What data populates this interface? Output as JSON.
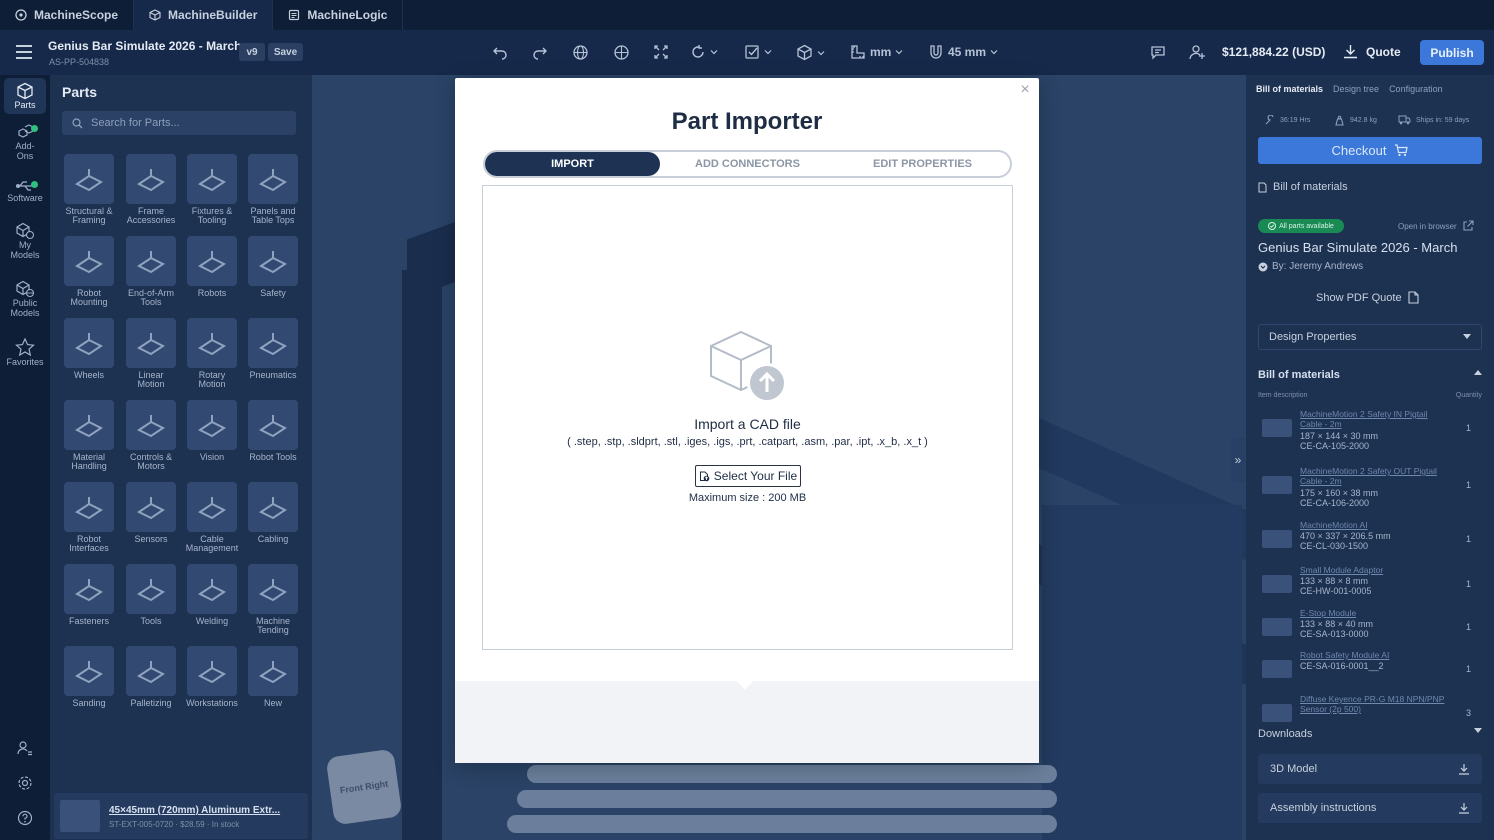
{
  "app_tabs": [
    {
      "label": "MachineScope",
      "icon": "scope-icon"
    },
    {
      "label": "MachineBuilder",
      "icon": "cube-icon"
    },
    {
      "label": "MachineLogic",
      "icon": "logic-icon"
    }
  ],
  "toolbar": {
    "design_title": "Genius Bar Simulate 2026 - March",
    "design_number": "AS-PP-504838",
    "version": "v9",
    "save_label": "Save",
    "units": "mm",
    "snap": "45 mm",
    "price": "$121,884.22 (USD)",
    "quote_label": "Quote",
    "publish_label": "Publish"
  },
  "rail": [
    {
      "label": "Parts",
      "icon": "parts-icon",
      "active": true
    },
    {
      "label": "Add-\nOns",
      "icon": "addons-icon",
      "dot": true
    },
    {
      "label": "Software",
      "icon": "software-icon",
      "dot": true
    },
    {
      "label": "My\nModels",
      "icon": "my-models-icon"
    },
    {
      "label": "Public\nModels",
      "icon": "public-models-icon"
    },
    {
      "label": "Favorites",
      "icon": "star-icon"
    }
  ],
  "parts_panel": {
    "title": "Parts",
    "search_placeholder": "Search for Parts...",
    "categories": [
      "Structural &\nFraming",
      "Frame\nAccessories",
      "Fixtures &\nTooling",
      "Panels and\nTable Tops",
      "Robot\nMounting",
      "End-of-Arm\nTools",
      "Robots",
      "Safety",
      "Wheels",
      "Linear\nMotion",
      "Rotary\nMotion",
      "Pneumatics",
      "Material\nHandling",
      "Controls &\nMotors",
      "Vision",
      "Robot Tools",
      "Robot\nInterfaces",
      "Sensors",
      "Cable\nManagement",
      "Cabling",
      "Fasteners",
      "Tools",
      "Welding",
      "Machine\nTending",
      "Sanding",
      "Palletizing",
      "Workstations",
      "New"
    ],
    "recent_part": {
      "name": "45×45mm (720mm) Aluminum Extr...",
      "sub": "ST-EXT-005-0720 · $28.59 · In stock"
    }
  },
  "view_cube": {
    "face1": "Front",
    "face2": "Right"
  },
  "right_panel": {
    "tabs": [
      "Bill of materials",
      "Design tree",
      "Configuration"
    ],
    "stats": {
      "hours": "36:19 Hrs",
      "weight": "942.8 kg",
      "ships": "Ships in: 59 days"
    },
    "checkout_label": "Checkout",
    "bom_section_label": "Bill of materials",
    "availability_badge": "All parts available",
    "open_in_browser": "Open in browser",
    "design_title": "Genius Bar Simulate 2026 - March",
    "author": "By: Jeremy Andrews",
    "pdf_quote": "Show PDF Quote",
    "design_properties": "Design Properties",
    "bom_header": "Bill of materials",
    "col_item": "Item description",
    "col_qty": "Quantity",
    "bom_items": [
      {
        "name": "MachineMotion 2 Safety IN Pigtail Cable - 2m",
        "dims": "187 × 144 × 30 mm",
        "code": "CE-CA-105-2000",
        "qty": "1"
      },
      {
        "name": "MachineMotion 2 Safety OUT Pigtail Cable - 2m",
        "dims": "175 × 160 × 38 mm",
        "code": "CE-CA-106-2000",
        "qty": "1"
      },
      {
        "name": "MachineMotion AI",
        "dims": "470 × 337 × 206.5 mm",
        "code": "CE-CL-030-1500",
        "qty": "1"
      },
      {
        "name": "Small Module Adaptor",
        "dims": "133 × 88 × 8 mm",
        "code": "CE-HW-001-0005",
        "qty": "1"
      },
      {
        "name": "E-Stop Module",
        "dims": "133 × 88 × 40 mm",
        "code": "CE-SA-013-0000",
        "qty": "1"
      },
      {
        "name": "Robot Safety Module AI",
        "dims": "",
        "code": "CE-SA-016-0001__2",
        "qty": "1"
      },
      {
        "name": "Diffuse Keyence PR-G M18 NPN/PNP Sensor (2p 500)",
        "dims": "",
        "code": "",
        "qty": "3"
      }
    ],
    "downloads_label": "Downloads",
    "download_3d": "3D Model",
    "download_assembly": "Assembly instructions"
  },
  "modal": {
    "title": "Part Importer",
    "tabs": [
      "IMPORT",
      "ADD CONNECTORS",
      "EDIT PROPERTIES"
    ],
    "active_tab": "IMPORT",
    "drop_title": "Import a CAD file",
    "file_types": "( .step, .stp, .sldprt, .stl, .iges, .igs, .prt, .catpart, .asm, .par, .ipt, .x_b, .x_t )",
    "select_button": "Select Your File",
    "max_size": "Maximum size : 200 MB",
    "close_symbol": "×"
  },
  "colors": {
    "topbar": "#0d1e36",
    "toolbar": "#16294a",
    "accent": "#3b78d9",
    "modal_tab_active": "#1e3354"
  }
}
